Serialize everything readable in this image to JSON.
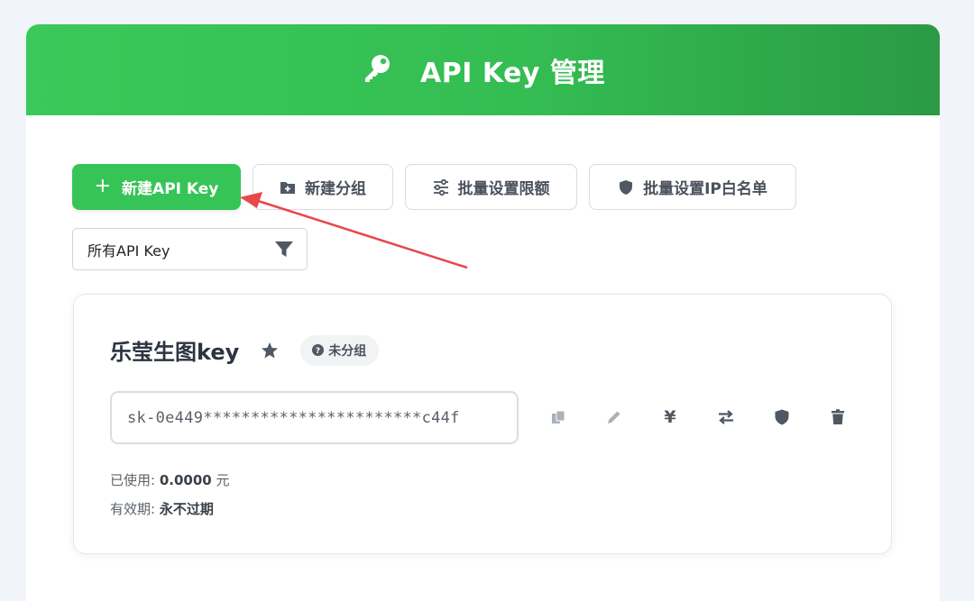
{
  "header": {
    "title": "API Key 管理",
    "icon": "key-icon"
  },
  "toolbar": {
    "new_key": "新建API Key",
    "new_group": "新建分组",
    "batch_limit": "批量设置限额",
    "batch_ip": "批量设置IP白名单"
  },
  "filter": {
    "selected": "所有API Key"
  },
  "card": {
    "title": "乐莹生图key",
    "badge": "未分组",
    "key_masked": "sk-0e449***********************c44f",
    "used_label": "已使用:",
    "used_value": "0.0000",
    "used_unit": "元",
    "expiry_label": "有效期:",
    "expiry_value": "永不过期"
  },
  "colors": {
    "accent": "#36c457",
    "annotation": "#e8474b"
  }
}
